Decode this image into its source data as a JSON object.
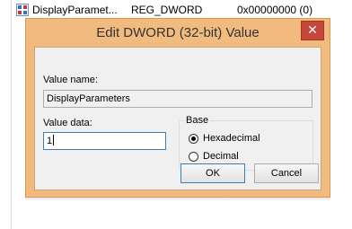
{
  "registry_row": {
    "name": "DisplayParamet...",
    "type": "REG_DWORD",
    "data": "0x00000000 (0)",
    "icon": "registry-binary-value-icon"
  },
  "dialog": {
    "title": "Edit DWORD (32-bit) Value",
    "close_symbol": "✕",
    "value_name_label": "Value name:",
    "value_name": "DisplayParameters",
    "value_data_label": "Value data:",
    "value_data": "1",
    "base_label": "Base",
    "base_options": [
      {
        "label": "Hexadecimal",
        "selected": true
      },
      {
        "label": "Decimal",
        "selected": false
      }
    ],
    "ok_label": "OK",
    "cancel_label": "Cancel"
  },
  "colors": {
    "frame": "#f1bb7f",
    "close": "#c7463a",
    "focus": "#3c7fb1"
  }
}
